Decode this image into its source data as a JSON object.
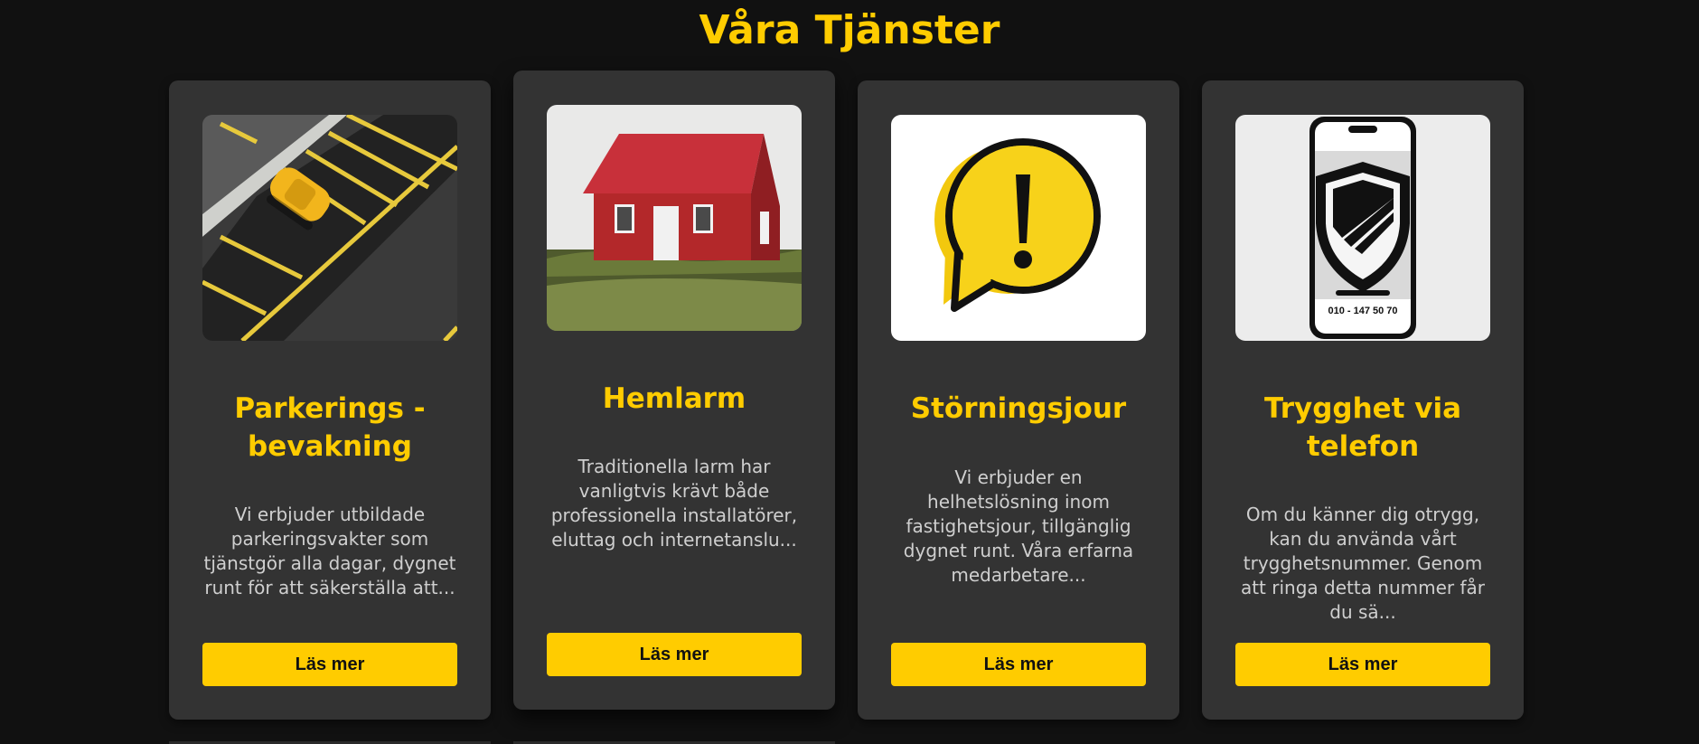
{
  "section": {
    "title": "Våra Tjänster"
  },
  "colors": {
    "background": "#111111",
    "card": "#333333",
    "accent": "#ffcc00",
    "text": "#cfcfcf"
  },
  "cards": [
    {
      "image": "parking-garage-yellow-car-photo",
      "title": "Parkerings - bevakning",
      "text": "Vi erbjuder utbildade parkeringsvakter som tjänstgör alla dagar, dygnet runt för att säkerställa att...",
      "button": "Läs mer"
    },
    {
      "image": "red-house-on-hill-photo",
      "title": "Hemlarm",
      "text": "Traditionella larm har vanligtvis krävt både professionella installatörer, eluttag och internetanslu...",
      "button": "Läs mer"
    },
    {
      "image": "exclamation-speech-bubble-icon",
      "title": "Störningsjour",
      "text": "Vi erbjuder en helhetslösning inom fastighetsjour, tillgänglig dygnet runt. Våra erfarna medarbetare...",
      "button": "Läs mer"
    },
    {
      "image": "phone-shield-icon",
      "title": "Trygghet via telefon",
      "text": "Om du känner dig otrygg, kan du använda vårt trygghetsnummer. Genom att ringa detta nummer får du sä...",
      "button": "Läs mer",
      "phone_number": "010 - 147 50 70"
    }
  ]
}
